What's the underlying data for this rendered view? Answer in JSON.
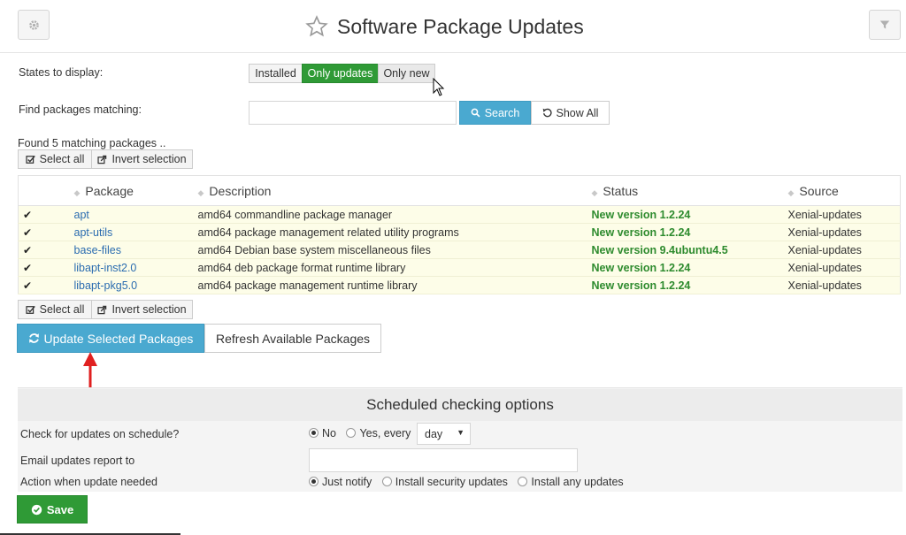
{
  "header": {
    "title": "Software Package Updates",
    "left_icon": "gear-icon",
    "right_icon": "filter-icon",
    "title_icon": "star-icon"
  },
  "states": {
    "label": "States to display:",
    "options": [
      "Installed",
      "Only updates",
      "Only new"
    ],
    "selected": "Only updates"
  },
  "find": {
    "label": "Find packages matching:",
    "value": "",
    "search_label": "Search",
    "show_all_label": "Show All"
  },
  "results": {
    "found_text": "Found 5 matching packages ..",
    "select_all_label": "Select all",
    "invert_label": "Invert selection"
  },
  "table": {
    "columns": [
      "Package",
      "Description",
      "Status",
      "Source"
    ],
    "rows": [
      {
        "package": "apt",
        "description": "amd64 commandline package manager",
        "status": "New version 1.2.24",
        "source": "Xenial-updates",
        "checked": true
      },
      {
        "package": "apt-utils",
        "description": "amd64 package management related utility programs",
        "status": "New version 1.2.24",
        "source": "Xenial-updates",
        "checked": true
      },
      {
        "package": "base-files",
        "description": "amd64 Debian base system miscellaneous files",
        "status": "New version 9.4ubuntu4.5",
        "source": "Xenial-updates",
        "checked": true
      },
      {
        "package": "libapt-inst2.0",
        "description": "amd64 deb package format runtime library",
        "status": "New version 1.2.24",
        "source": "Xenial-updates",
        "checked": true
      },
      {
        "package": "libapt-pkg5.0",
        "description": "amd64 package management runtime library",
        "status": "New version 1.2.24",
        "source": "Xenial-updates",
        "checked": true
      }
    ]
  },
  "actions": {
    "update_label": "Update Selected Packages",
    "refresh_label": "Refresh Available Packages"
  },
  "schedule": {
    "title": "Scheduled checking options",
    "check_label": "Check for updates on schedule?",
    "check_no": "No",
    "check_yes": "Yes, every",
    "interval_value": "day",
    "email_label": "Email updates report to",
    "email_value": "",
    "action_label": "Action when update needed",
    "action_options": [
      "Just notify",
      "Install security updates",
      "Install any updates"
    ],
    "action_selected": "Just notify",
    "save_label": "Save"
  },
  "colors": {
    "green": "#2f9a36",
    "blue": "#4aa9d0",
    "row_highlight": "#fdfde8",
    "arrow": "#e02020"
  }
}
